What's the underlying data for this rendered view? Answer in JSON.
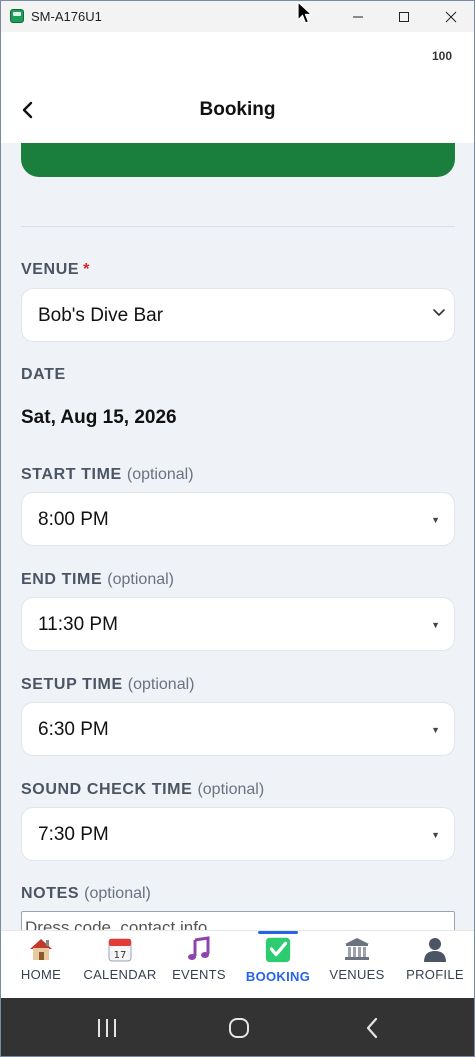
{
  "window": {
    "title": "SM-A176U1"
  },
  "status": {
    "battery": "100"
  },
  "header": {
    "title": "Booking"
  },
  "form": {
    "venue": {
      "label": "VENUE",
      "required_mark": "*",
      "value": "Bob's Dive Bar"
    },
    "date": {
      "label": "DATE",
      "value": "Sat, Aug 15, 2026"
    },
    "start_time": {
      "label": "START TIME",
      "optional": "(optional)",
      "value": "8:00 PM"
    },
    "end_time": {
      "label": "END TIME",
      "optional": "(optional)",
      "value": "11:30 PM"
    },
    "setup_time": {
      "label": "SETUP TIME",
      "optional": "(optional)",
      "value": "6:30 PM"
    },
    "sound_check_time": {
      "label": "SOUND CHECK TIME",
      "optional": "(optional)",
      "value": "7:30 PM"
    },
    "notes": {
      "label": "NOTES",
      "optional": "(optional)",
      "placeholder": "Dress code, contact info..."
    }
  },
  "tabs": [
    {
      "label": "HOME",
      "icon": "home-icon"
    },
    {
      "label": "CALENDAR",
      "icon": "calendar-icon",
      "icon_text": "17"
    },
    {
      "label": "EVENTS",
      "icon": "music-note-icon"
    },
    {
      "label": "BOOKING",
      "icon": "check-box-icon",
      "active": true
    },
    {
      "label": "VENUES",
      "icon": "venue-building-icon"
    },
    {
      "label": "PROFILE",
      "icon": "profile-silhouette-icon"
    }
  ],
  "colors": {
    "accent": "#2563eb",
    "primary_button": "#1a7f3c",
    "required": "#dc2626",
    "background": "#eff2f7"
  }
}
